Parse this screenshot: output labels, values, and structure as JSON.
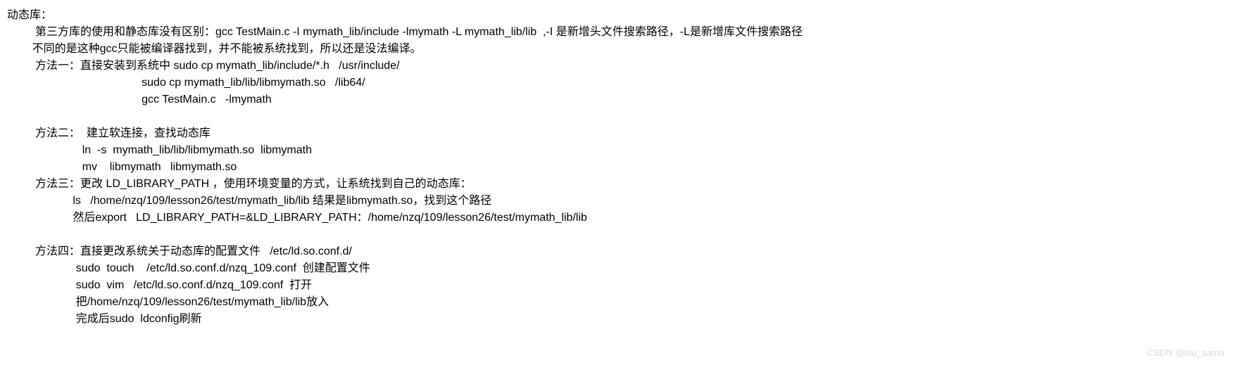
{
  "lines": {
    "l1": "动态库：",
    "l2": "         第三方库的使用和静态库没有区别：gcc TestMain.c -I mymath_lib/include -lmymath -L mymath_lib/lib  ,-I 是新增头文件搜索路径，-L是新增库文件搜索路径",
    "l3": "        不同的是这种gcc只能被编译器找到，并不能被系统找到，所以还是没法编译。",
    "l4": "         方法一：直接安装到系统中 sudo cp mymath_lib/include/*.h   /usr/include/",
    "l5": "                                           sudo cp mymath_lib/lib/libmymath.so   /lib64/",
    "l6": "                                           gcc TestMain.c   -lmymath",
    "l7": " ",
    "l8": "         方法二：  建立软连接，查找动态库",
    "l9": "                        ln  -s  mymath_lib/lib/libmymath.so  libmymath",
    "l10": "                        mv    libmymath   libmymath.so",
    "l11": "         方法三：更改 LD_LIBRARY_PATH ，使用环境变量的方式，让系统找到自己的动态库：",
    "l12": "                     ls   /home/nzq/109/lesson26/test/mymath_lib/lib 结果是libmymath.so，找到这个路径",
    "l13": "                     然后export   LD_LIBRARY_PATH=&LD_LIBRARY_PATH：/home/nzq/109/lesson26/test/mymath_lib/lib",
    "l14": " ",
    "l15": "         方法四：直接更改系统关于动态库的配置文件   /etc/ld.so.conf.d/",
    "l16": "                      sudo  touch    /etc/ld.so.conf.d/nzq_109.conf  创建配置文件",
    "l17": "                      sudo  vim   /etc/ld.so.conf.d/nzq_109.conf  打开",
    "l18": "                      把/home/nzq/109/lesson26/test/mymath_lib/lib放入",
    "l19": "                      完成后sudo  ldconfig刷新"
  },
  "watermark": "CSDN @niu_sama"
}
